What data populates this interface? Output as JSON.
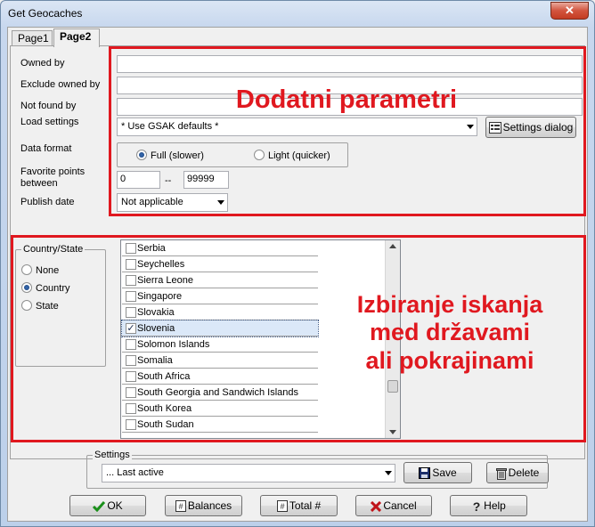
{
  "window": {
    "title": "Get Geocaches",
    "close_glyph": "✕"
  },
  "tabs": [
    {
      "label": "Page1"
    },
    {
      "label": "Page2"
    }
  ],
  "fields": {
    "owned_by": "Owned by",
    "exclude_owned_by": "Exclude owned by",
    "not_found_by": "Not found by",
    "load_settings": "Load settings",
    "load_settings_value": "* Use GSAK defaults *",
    "settings_dialog_button": "Settings dialog",
    "data_format": "Data format",
    "format_full": "Full (slower)",
    "format_light": "Light (quicker)",
    "favorite_points": "Favorite points",
    "favorite_between": "between",
    "fav_min": "0",
    "fav_dash": "--",
    "fav_max": "99999",
    "publish_date": "Publish date",
    "publish_date_value": "Not applicable"
  },
  "country_state": {
    "title": "Country/State",
    "options": [
      "None",
      "Country",
      "State"
    ],
    "selected": "Country"
  },
  "countries": [
    {
      "name": "Serbia",
      "checked": false
    },
    {
      "name": "Seychelles",
      "checked": false
    },
    {
      "name": "Sierra Leone",
      "checked": false
    },
    {
      "name": "Singapore",
      "checked": false
    },
    {
      "name": "Slovakia",
      "checked": false
    },
    {
      "name": "Slovenia",
      "checked": true
    },
    {
      "name": "Solomon Islands",
      "checked": false
    },
    {
      "name": "Somalia",
      "checked": false
    },
    {
      "name": "South Africa",
      "checked": false
    },
    {
      "name": "South Georgia and Sandwich Islands",
      "checked": false
    },
    {
      "name": "South Korea",
      "checked": false
    },
    {
      "name": "South Sudan",
      "checked": false
    }
  ],
  "annotations": {
    "top": "Dodatni parametri",
    "bottom": [
      "Izbiranje iskanja",
      "med državami",
      "ali pokrajinami"
    ]
  },
  "settings_group": {
    "title": "Settings",
    "value": "... Last active",
    "save": "Save",
    "delete": "Delete"
  },
  "bottom_buttons": {
    "ok": "OK",
    "balances": "Balances",
    "total": "Total #",
    "cancel": "Cancel",
    "help": "Help"
  },
  "colors": {
    "annotation_red": "#e0181f",
    "selected_row": "#dbe8f8"
  },
  "icons": [
    "settings-dialog-icon",
    "save-disk-icon",
    "delete-trash-icon",
    "ok-check-icon",
    "balances-icon",
    "total-icon",
    "cancel-x-icon",
    "help-question-icon"
  ]
}
